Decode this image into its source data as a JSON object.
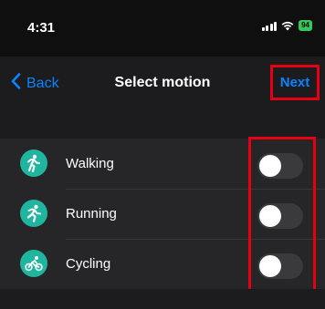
{
  "status_bar": {
    "time": "4:31",
    "battery": "94",
    "signal_icon": "cellular-signal-icon",
    "wifi_icon": "wifi-icon"
  },
  "nav": {
    "back_label": "Back",
    "title": "Select motion",
    "next_label": "Next"
  },
  "motions": [
    {
      "label": "Walking",
      "icon": "walking-icon",
      "enabled": false
    },
    {
      "label": "Running",
      "icon": "running-icon",
      "enabled": false
    },
    {
      "label": "Cycling",
      "icon": "cycling-icon",
      "enabled": false
    }
  ],
  "colors": {
    "accent": "#0a84ff",
    "icon_bg": "#20b59f",
    "highlight": "#e60012"
  }
}
